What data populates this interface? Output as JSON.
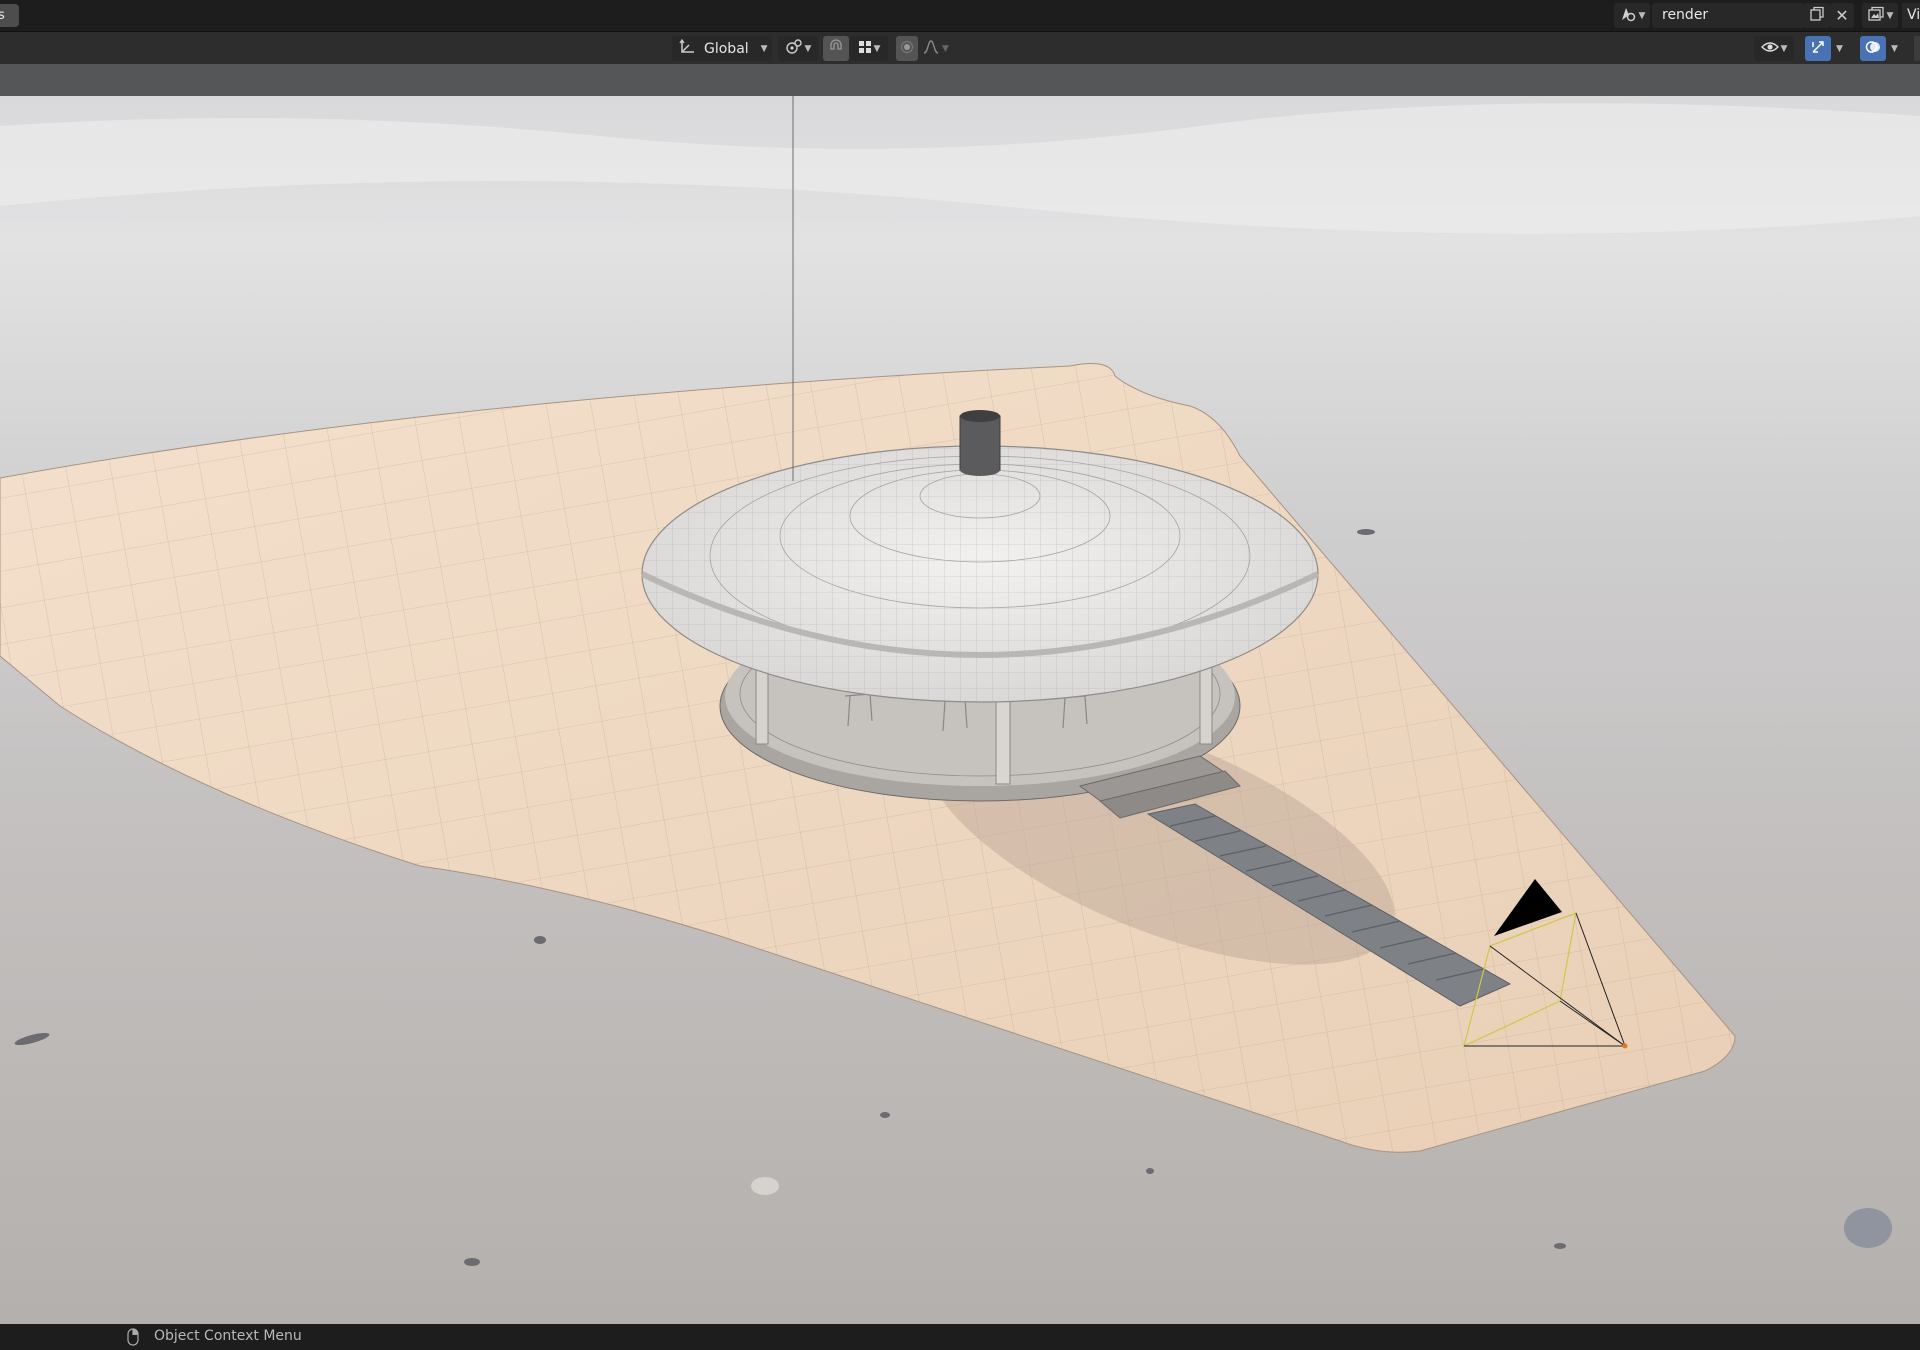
{
  "topbar": {
    "workspace_tab_label": "s",
    "scene_name": "render",
    "view_layer_label": "Vi"
  },
  "header": {
    "transform_orientation": "Global"
  },
  "statusbar": {
    "hint": "Object Context Menu"
  },
  "colors": {
    "accent_blue": "#4772b3",
    "header_bg": "#2d2d2d",
    "topbar_bg": "#1d1d1d"
  }
}
